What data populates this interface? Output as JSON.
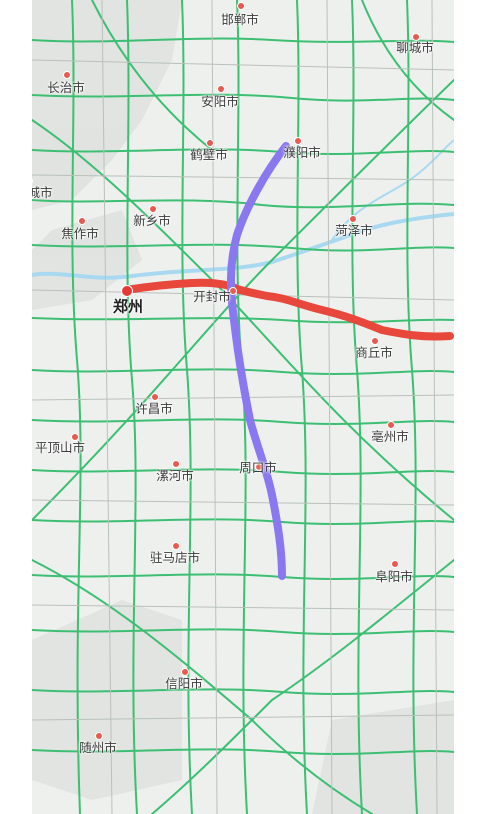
{
  "map": {
    "cities": [
      {
        "id": "handan",
        "name": "邯郸市",
        "major": false
      },
      {
        "id": "liaocheng",
        "name": "聊城市",
        "major": false
      },
      {
        "id": "changzhi",
        "name": "长治市",
        "major": false
      },
      {
        "id": "anyang",
        "name": "安阳市",
        "major": false
      },
      {
        "id": "hebi",
        "name": "鹤壁市",
        "major": false
      },
      {
        "id": "puyang",
        "name": "濮阳市",
        "major": false
      },
      {
        "id": "jincheng",
        "name": "城市",
        "major": false
      },
      {
        "id": "xinxiang",
        "name": "新乡市",
        "major": false
      },
      {
        "id": "heze",
        "name": "菏泽市",
        "major": false
      },
      {
        "id": "jiaozuo",
        "name": "焦作市",
        "major": false
      },
      {
        "id": "zhengzhou",
        "name": "郑州",
        "major": true
      },
      {
        "id": "kaifeng",
        "name": "开封市",
        "major": false
      },
      {
        "id": "shangqiu",
        "name": "商丘市",
        "major": false
      },
      {
        "id": "xuchang",
        "name": "许昌市",
        "major": false
      },
      {
        "id": "bozhou",
        "name": "亳州市",
        "major": false
      },
      {
        "id": "pingdingshan",
        "name": "平顶山市",
        "major": false
      },
      {
        "id": "zhoukou",
        "name": "周口市",
        "major": false
      },
      {
        "id": "luohe",
        "name": "漯河市",
        "major": false
      },
      {
        "id": "zhumadian",
        "name": "驻马店市",
        "major": false
      },
      {
        "id": "fuyang",
        "name": "阜阳市",
        "major": false
      },
      {
        "id": "xinyang",
        "name": "信阳市",
        "major": false
      },
      {
        "id": "suizhou",
        "name": "随州市",
        "major": false
      }
    ],
    "route_colors": {
      "east_west": "#e8473c",
      "north_south": "#8a78f0"
    },
    "road_color": "#3dbf73",
    "river_color": "#a9d9f0"
  }
}
